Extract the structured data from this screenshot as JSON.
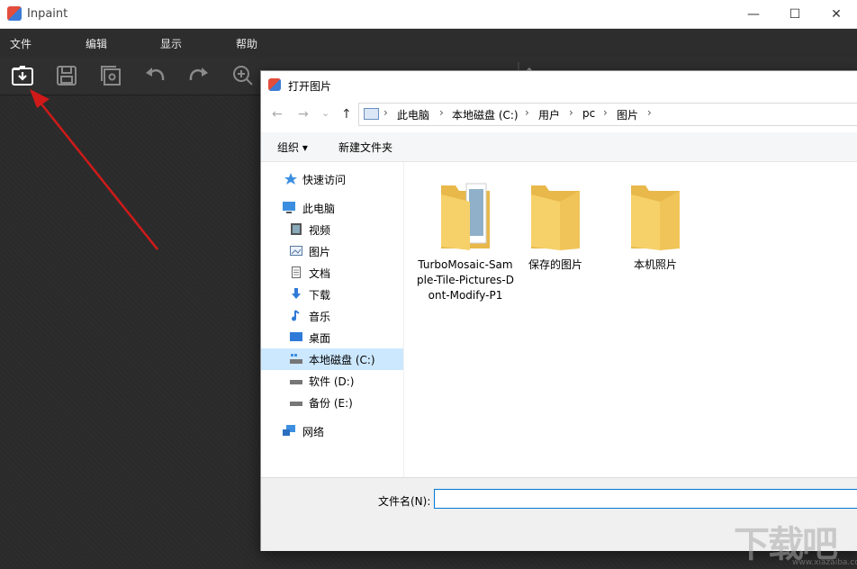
{
  "app": {
    "title": "Inpaint",
    "menu": [
      "文件",
      "编辑",
      "显示",
      "帮助"
    ],
    "window_controls": {
      "minimize": "—",
      "maximize": "☐",
      "close": "✕"
    }
  },
  "dialog": {
    "title": "打开图片",
    "nav_buttons": {
      "back": "←",
      "forward": "→",
      "dropdown": "⌄",
      "up": "↑"
    },
    "breadcrumb": [
      "此电脑",
      "本地磁盘 (C:)",
      "用户",
      "pc",
      "图片"
    ],
    "breadcrumb_separator": "›",
    "commands": {
      "organize": "组织 ▾",
      "new_folder": "新建文件夹"
    },
    "nav_items": [
      {
        "label": "快速访问",
        "icon": "star-icon"
      },
      {
        "label": "此电脑",
        "icon": "computer-icon"
      },
      {
        "label": "视频",
        "icon": "video-icon"
      },
      {
        "label": "图片",
        "icon": "picture-icon"
      },
      {
        "label": "文档",
        "icon": "document-icon"
      },
      {
        "label": "下载",
        "icon": "download-icon"
      },
      {
        "label": "音乐",
        "icon": "music-icon"
      },
      {
        "label": "桌面",
        "icon": "desktop-icon"
      },
      {
        "label": "本地磁盘 (C:)",
        "icon": "drive-icon",
        "selected": true
      },
      {
        "label": "软件 (D:)",
        "icon": "drive-icon"
      },
      {
        "label": "备份 (E:)",
        "icon": "drive-icon"
      },
      {
        "label": "网络",
        "icon": "network-icon"
      }
    ],
    "folders": [
      {
        "label": "TurboMosaic-Sample-Tile-Pictures-Dont-Modify-P1"
      },
      {
        "label": "保存的图片"
      },
      {
        "label": "本机照片"
      }
    ],
    "filename_label": "文件名(N):",
    "filename_value": ""
  },
  "watermark": {
    "text": "下载吧",
    "url": "www.xiazaiba.com"
  },
  "colors": {
    "accent": "#0078d7",
    "selected": "#cce8ff",
    "folder": "#f6d069",
    "arrow": "#d01a1a"
  }
}
